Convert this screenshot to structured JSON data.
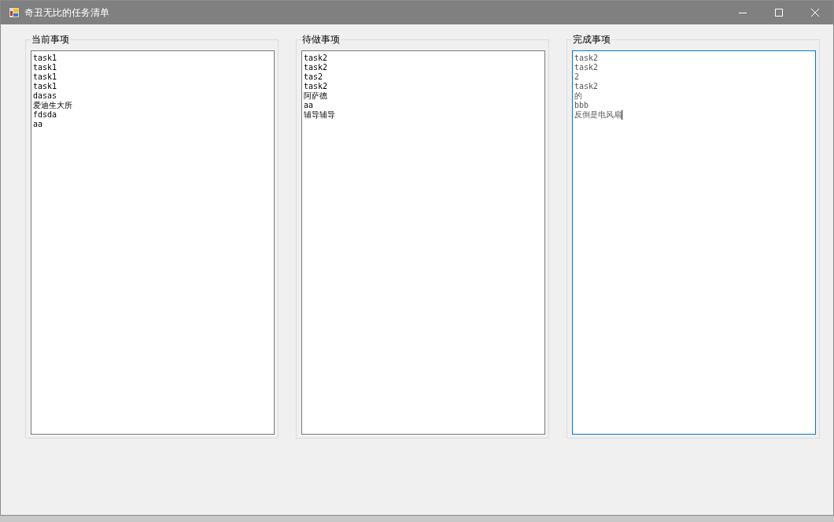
{
  "window": {
    "title": "奇丑无比的任务清单"
  },
  "groups": [
    {
      "title": "当前事项",
      "focused": false,
      "lines": [
        "task1",
        "task1",
        "task1",
        "task1",
        "dasas",
        "爱迪生大所",
        "fdsda",
        "aa"
      ]
    },
    {
      "title": "待做事项",
      "focused": false,
      "lines": [
        "task2",
        "task2",
        "tas2",
        "task2",
        "阿萨德",
        "aa",
        "辅导辅导"
      ]
    },
    {
      "title": "完成事项",
      "focused": true,
      "lines": [
        "task2",
        "task2",
        "2",
        "task2",
        "的",
        "bbb",
        "反倒是电风扇"
      ]
    }
  ]
}
